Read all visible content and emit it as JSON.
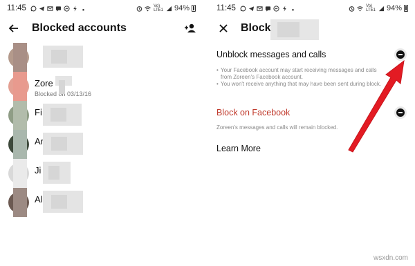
{
  "colors": {
    "danger_red": "#c0392b",
    "annotation_arrow": "#e31b23"
  },
  "left_screen": {
    "status": {
      "time": "11:45",
      "lte": [
        "Vo)",
        "LTE1"
      ],
      "battery": "94%"
    },
    "title": "Blocked accounts",
    "back_icon": "arrow-left-icon",
    "add_icon": "add-person-icon",
    "contacts": [
      {
        "name": "",
        "sub": ""
      },
      {
        "name": "Zore",
        "sub": "Blocked on 03/13/16"
      },
      {
        "name": "Fi",
        "sub": ""
      },
      {
        "name": "Ar",
        "sub": ""
      },
      {
        "name": "Ji",
        "sub": ""
      },
      {
        "name": "Al",
        "sub": ""
      }
    ]
  },
  "right_screen": {
    "status": {
      "time": "11:45",
      "lte": [
        "Vo)",
        "LTE1"
      ],
      "battery": "94%"
    },
    "title": "Block",
    "close_icon": "close-icon",
    "unblock": {
      "title": "Unblock messages and calls",
      "bullets": [
        "Your Facebook account may start receiving messages and calls from Zoreen's Facebook account.",
        "You won't receive anything that may have been sent during block."
      ]
    },
    "block_facebook": {
      "title": "Block on Facebook",
      "note": "Zoreen's messages and calls will remain blocked."
    },
    "learn_more": "Learn More"
  },
  "watermark": "wsxdn.com"
}
